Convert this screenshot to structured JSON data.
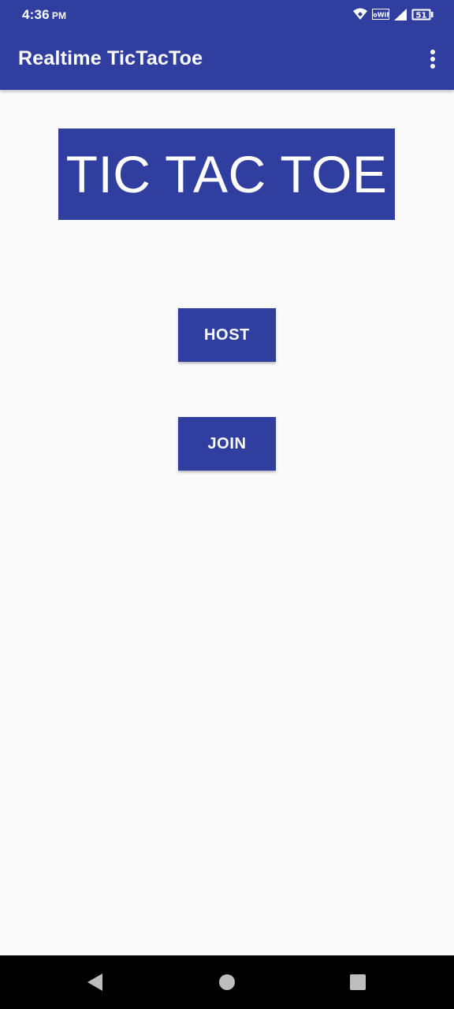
{
  "status_bar": {
    "time": "4:36",
    "ampm": "PM",
    "battery_level": "51",
    "icons": [
      "hotspot-icon",
      "vowifi-icon",
      "signal-icon",
      "battery-icon"
    ]
  },
  "app_bar": {
    "title": "Realtime TicTacToe",
    "overflow_icon": "more-vert-icon"
  },
  "main": {
    "banner_text": "TIC TAC TOE",
    "host_label": "HOST",
    "join_label": "JOIN"
  },
  "nav_bar": {
    "icons": [
      "back-icon",
      "home-icon",
      "recents-icon"
    ]
  },
  "colors": {
    "primary": "#303f9f",
    "background": "#fafafa",
    "text_on_primary": "#ffffff",
    "nav_bar": "#000000",
    "nav_icon": "#bdbdbd"
  }
}
